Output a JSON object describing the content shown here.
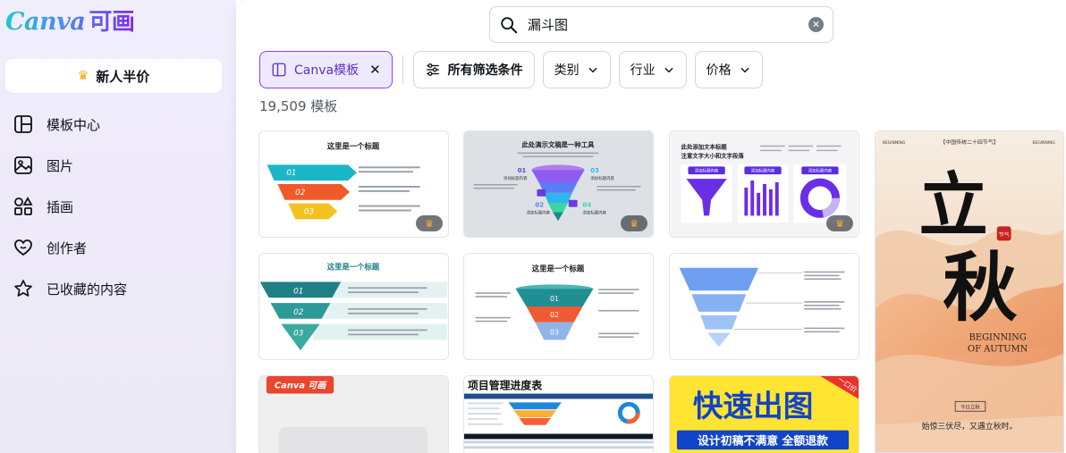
{
  "sidebar": {
    "logo_text": "Canva",
    "logo_cn": "可画",
    "promo_label": "新人半价",
    "items": [
      {
        "label": "模板中心",
        "icon": "template-icon"
      },
      {
        "label": "图片",
        "icon": "image-icon"
      },
      {
        "label": "插画",
        "icon": "shapes-icon"
      },
      {
        "label": "创作者",
        "icon": "creator-heart-icon"
      },
      {
        "label": "已收藏的内容",
        "icon": "star-icon"
      }
    ]
  },
  "search": {
    "value": "漏斗图"
  },
  "filters": {
    "active_chip": "Canva模板",
    "all_filters": "所有筛选条件",
    "dropdowns": [
      "类别",
      "行业",
      "价格"
    ]
  },
  "results": {
    "count_label": "19,509 模板"
  },
  "templates": {
    "t1": {
      "title": "这里是一个标题",
      "steps": [
        "01",
        "02",
        "03"
      ]
    },
    "t2": {
      "title": "此处演示文稿是一种工具",
      "steps": [
        "01",
        "02",
        "03",
        "04"
      ],
      "label": "添加标题内容"
    },
    "t3": {
      "title": "此处添加文本标题",
      "subtitle": "注意文字大小和文字段落",
      "col_label": "添加标题内容"
    },
    "t4": {
      "title": "这里是一个标题",
      "steps": [
        "01",
        "02",
        "03"
      ]
    },
    "t5": {
      "title": "这里是一个标题",
      "steps": [
        "01",
        "02",
        "03"
      ]
    },
    "t7": {
      "logo": "Canva 可画"
    },
    "t8": {
      "title": "项目管理进度表"
    },
    "t9": {
      "title": "快速出图",
      "ribbon": "一口价",
      "subtitle": "设计初稿不满意 全额退款"
    },
    "t10": {
      "header": "【中国传统二十四节气】",
      "big1": "立",
      "big2": "秋",
      "en1": "BEGINNING",
      "en2": "OF AUTUMN",
      "tag": "今日立秋",
      "poem": "始惊三伏尽，又遇立秋时。",
      "seal": "节气"
    }
  },
  "colors": {
    "accent": "#8b3dff",
    "premium": "#f7b32b"
  }
}
